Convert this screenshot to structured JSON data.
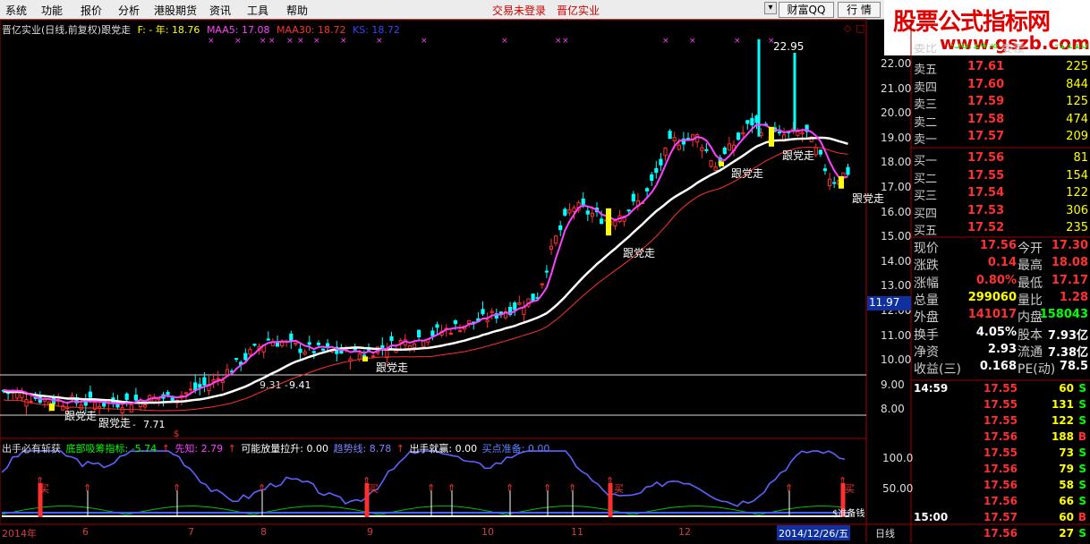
{
  "menu": {
    "items": [
      "系统",
      "功能",
      "报价",
      "分析",
      "港股期货",
      "资讯",
      "工具",
      "帮助"
    ],
    "status": "交易未登录",
    "stock": "晋亿实业",
    "btn_wealth": "财富QQ",
    "btn_quote": "行 情"
  },
  "watermark": {
    "line1": "股票公式指标网",
    "line2": "www.gszb.com"
  },
  "chart": {
    "title": "晋亿实业(日线,前复权)跟党走",
    "f": "F: - 年: 18.76",
    "maa5": "MAA5: 17.08",
    "maa30": "MAA30: 18.72",
    "ks": "KS: 18.72",
    "high_label": "22.95",
    "low_label": "7.71",
    "mid_label": "9.41",
    "mid_label_prefix": "9.31 -",
    "low_prefix": "-",
    "signal": "跟党走",
    "price_box": "11.97"
  },
  "y_axis": [
    "22.00",
    "21.00",
    "20.00",
    "19.00",
    "18.00",
    "17.00",
    "16.00",
    "15.00",
    "14.00",
    "13.00",
    "12.00",
    "11.00",
    "10.00",
    "9.00",
    "8.00"
  ],
  "indicator": {
    "name": "出手必有斩获",
    "a": "底部吸筹指标: -5.74",
    "b": "先知: 2.79",
    "c": "可能放量拉升: 0.00",
    "d": "趋势线: 8.78",
    "e": "出手就赢: 0.00",
    "f": "买点准备: 0.00",
    "y1": "100.0",
    "y2": "50.00",
    "buy": "买",
    "buy2": "买",
    "money": "$准备钱",
    "dollar": "$"
  },
  "x_axis": {
    "labels": [
      "2014年",
      "6",
      "7",
      "8",
      "9",
      "10",
      "11",
      "12"
    ],
    "date": "2014/12/26/五",
    "period": "日线"
  },
  "order_book": {
    "sell": [
      {
        "label": "卖五",
        "price": "17.61",
        "vol": "225"
      },
      {
        "label": "卖四",
        "price": "17.60",
        "vol": "844"
      },
      {
        "label": "卖三",
        "price": "17.59",
        "vol": "125"
      },
      {
        "label": "卖二",
        "price": "17.58",
        "vol": "474"
      },
      {
        "label": "卖一",
        "price": "17.57",
        "vol": "209"
      }
    ],
    "buy": [
      {
        "label": "买一",
        "price": "17.56",
        "vol": "81"
      },
      {
        "label": "买二",
        "price": "17.55",
        "vol": "154"
      },
      {
        "label": "买三",
        "price": "17.54",
        "vol": "122"
      },
      {
        "label": "买四",
        "price": "17.53",
        "vol": "306"
      },
      {
        "label": "买五",
        "price": "17.52",
        "vol": "235"
      }
    ],
    "partial": {
      "label": "委比",
      "value": "-58.14%",
      "label2": "委差",
      "value2": "-1110"
    }
  },
  "stats": [
    {
      "l1": "现价",
      "v1": "17.56",
      "l2": "今开",
      "v2": "17.30"
    },
    {
      "l1": "涨跌",
      "v1": "0.14",
      "l2": "最高",
      "v2": "18.08"
    },
    {
      "l1": "涨幅",
      "v1": "0.80%",
      "l2": "最低",
      "v2": "17.17"
    },
    {
      "l1": "总量",
      "v1": "299060",
      "l2": "量比",
      "v2": "1.28"
    },
    {
      "l1": "外盘",
      "v1": "141017",
      "l2": "内盘",
      "v2": "158043"
    },
    {
      "l1": "换手",
      "v1": "4.05%",
      "l2": "股本",
      "v2": "7.93亿"
    },
    {
      "l1": "净资",
      "v1": "2.93",
      "l2": "流通",
      "v2": "7.38亿"
    },
    {
      "l1": "收益(三)",
      "v1": "0.168",
      "l2": "PE(动)",
      "v2": "78.5"
    }
  ],
  "ticks": [
    {
      "time": "14:59",
      "price": "17.55",
      "vol": "60",
      "bs": "S"
    },
    {
      "time": "",
      "price": "17.55",
      "vol": "131",
      "bs": "S"
    },
    {
      "time": "",
      "price": "17.55",
      "vol": "122",
      "bs": "S"
    },
    {
      "time": "",
      "price": "17.56",
      "vol": "188",
      "bs": "B"
    },
    {
      "time": "",
      "price": "17.55",
      "vol": "73",
      "bs": "S"
    },
    {
      "time": "",
      "price": "17.56",
      "vol": "79",
      "bs": "S"
    },
    {
      "time": "",
      "price": "17.56",
      "vol": "58",
      "bs": "S"
    },
    {
      "time": "",
      "price": "17.56",
      "vol": "66",
      "bs": "S"
    },
    {
      "time": "15:00",
      "price": "17.57",
      "vol": "60",
      "bs": "B"
    },
    {
      "time": "",
      "price": "17.56",
      "vol": "27",
      "bs": "S"
    }
  ],
  "colors": {
    "up": "#ff3030",
    "down": "#00ffff",
    "maa5": "#ff40ff",
    "maa30": "#ffffff",
    "ks": "#ff3030",
    "yellow": "#ffff00"
  }
}
